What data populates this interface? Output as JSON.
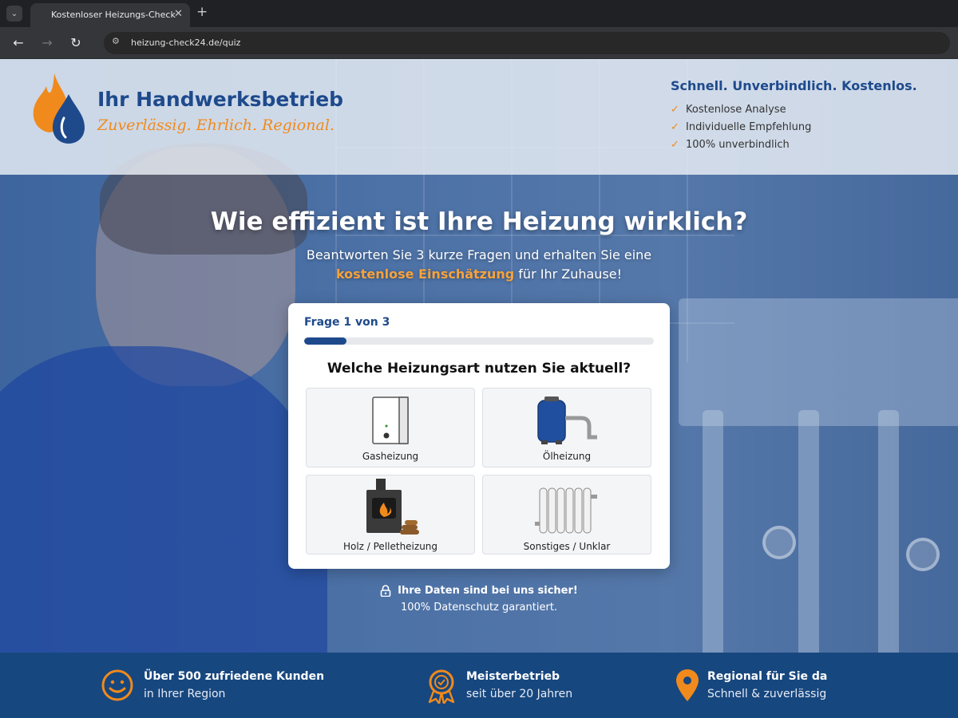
{
  "browser": {
    "tab_title": "Kostenloser Heizungs-Check",
    "tab_close": "✕",
    "new_tab": "+",
    "url": "heizung-check24.de/quiz"
  },
  "header": {
    "brand_name": "Ihr Handwerksbetrieb",
    "brand_tagline": "Zuverlässig. Ehrlich. Regional.",
    "usp_title": "Schnell. Unverbindlich. Kostenlos.",
    "usp_items": [
      "Kostenlose Analyse",
      "Individuelle Empfehlung",
      "100% unverbindlich"
    ]
  },
  "hero": {
    "title": "Wie effizient ist Ihre Heizung wirklich?",
    "subtitle_line1": "Beantworten Sie 3 kurze Fragen und erhalten Sie eine",
    "subtitle_highlight": "kostenlose Einschätzung",
    "subtitle_rest": " für Ihr Zuhause!"
  },
  "quiz": {
    "step_label": "Frage 1 von 3",
    "progress": 0.12,
    "question": "Welche Heizungsart nutzen Sie aktuell?",
    "options": [
      {
        "label": "Gasheizung",
        "icon": "gas-boiler-icon"
      },
      {
        "label": "Ölheizung",
        "icon": "oil-tank-icon"
      },
      {
        "label": "Holz / Pelletheizung",
        "icon": "wood-stove-icon"
      },
      {
        "label": "Sonstiges / Unklar",
        "icon": "radiator-icon"
      }
    ]
  },
  "privacy": {
    "line1": "Ihre Daten sind bei uns sicher!",
    "line2": "100% Datenschutz garantiert."
  },
  "footer": {
    "items": [
      {
        "title": "Über 500 zufriedene Kunden",
        "subtitle": "in Ihrer Region",
        "icon": "smiley-icon"
      },
      {
        "title": "Meisterbetrieb",
        "subtitle": "seit über 20 Jahren",
        "icon": "award-badge-icon"
      },
      {
        "title": "Regional für Sie da",
        "subtitle": "Schnell & zuverlässig",
        "icon": "location-pin-icon"
      }
    ]
  },
  "colors": {
    "primary": "#1e4a8c",
    "accent": "#f08a1c",
    "footer_bg": "#17477f"
  }
}
